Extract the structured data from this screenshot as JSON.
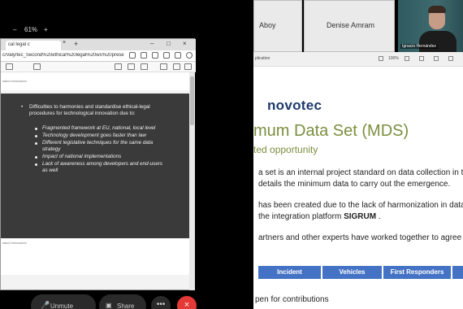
{
  "zoom_bar": {
    "minus": "–",
    "level": "61%",
    "plus": "+"
  },
  "browser": {
    "tab_title": "cal legal c",
    "tab_close": "×",
    "new_tab": "+",
    "address": "c/Valy/tec_Second%20ethical%20legal%20ws%20presentat...",
    "window_controls": {
      "minimize": "–",
      "maximize": "□",
      "close": "×"
    }
  },
  "pdf_page": {
    "header_tiny": "salud innovación",
    "footer_tiny": "salud innovación",
    "main_bullet": "Difficulties to harmonies and standardise ethical-legal procedures for technological innovation due to:",
    "sub_bullets": [
      "Fragmented framework at EU, national, local level",
      "Technology development goes faster than law",
      "Different legislative techniques for the same data strategy",
      "Impact of national implementations",
      "Lack of awareness among developers and end-users as well"
    ]
  },
  "participants": [
    {
      "name": "Aboy"
    },
    {
      "name": "Denise Amram"
    },
    {
      "name": "Ignacio Hernández"
    }
  ],
  "presentation": {
    "tab_label": "plication",
    "zoom": "100%",
    "logo": "novotec",
    "title": "mum Data Set (MDS)",
    "subtitle": "ted opportunity",
    "lines": [
      "a set is an internal project standard on data collection in th",
      "details the minimum data to carry out the emergence.",
      "has been created due to the lack of harmonization in data",
      "the integration platform",
      "artners and other experts have worked together to agree o"
    ],
    "platform_name": "SIGRUM",
    "platform_suffix": " .",
    "table_headers": [
      "Incident",
      "Vehicles",
      "First Responders"
    ],
    "open_text": "pen for contributions"
  },
  "controls": {
    "unmute": "Unmute",
    "share": "Share",
    "more": "•••",
    "end": "×"
  }
}
